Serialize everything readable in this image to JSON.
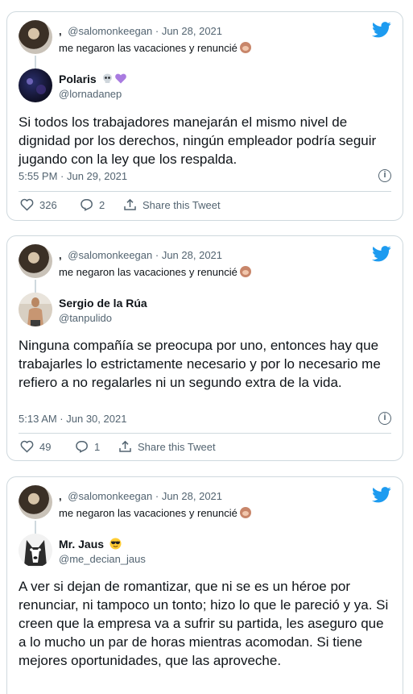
{
  "tweets": [
    {
      "parent": {
        "name": ",",
        "handle": "@salomonkeegan",
        "separator": "·",
        "date": "Jun 28, 2021",
        "text": "me negaron las vacaciones y renuncié"
      },
      "author": {
        "name": "Polaris",
        "handle": "@lornadanep",
        "name_emojis": [
          "skull-icon",
          "purple-heart-icon"
        ]
      },
      "text": "Si todos los trabajadores manejarán el mismo nivel de dignidad por los derechos, ningún empleador podría seguir jugando con la ley que los respalda.",
      "timestamp": "5:55 PM · Jun 29, 2021",
      "likes": "326",
      "replies": "2",
      "share_label": "Share this Tweet"
    },
    {
      "parent": {
        "name": ",",
        "handle": "@salomonkeegan",
        "separator": "·",
        "date": "Jun 28, 2021",
        "text": "me negaron las vacaciones y renuncié"
      },
      "author": {
        "name": "Sergio de la Rúa",
        "handle": "@tanpulido"
      },
      "text": "Ninguna compañía se preocupa por uno, entonces hay que trabajarles lo estrictamente necesario y por lo necesario me refiero a no regalarles ni un segundo extra de la vida.",
      "timestamp": "5:13 AM · Jun 30, 2021",
      "likes": "49",
      "replies": "1",
      "share_label": "Share this Tweet"
    },
    {
      "parent": {
        "name": ",",
        "handle": "@salomonkeegan",
        "separator": "·",
        "date": "Jun 28, 2021",
        "text": "me negaron las vacaciones y renuncié"
      },
      "author": {
        "name": "Mr. Jaus",
        "handle": "@me_decian_jaus",
        "name_emojis": [
          "sunglasses-face-icon"
        ]
      },
      "text": "A ver si dejan de romantizar, que ni se es un héroe por renunciar, ni tampoco un tonto; hizo lo que le pareció y ya.  Si creen que la empresa va a sufrir su partida, les aseguro que a lo mucho un par de horas mientras acomodan. Si tiene mejores oportunidades, que las aproveche."
    }
  ],
  "colors": {
    "twitter_blue": "#1d9bf0",
    "text_primary": "#0f1419",
    "text_secondary": "#536471",
    "border": "#cfd9de"
  }
}
